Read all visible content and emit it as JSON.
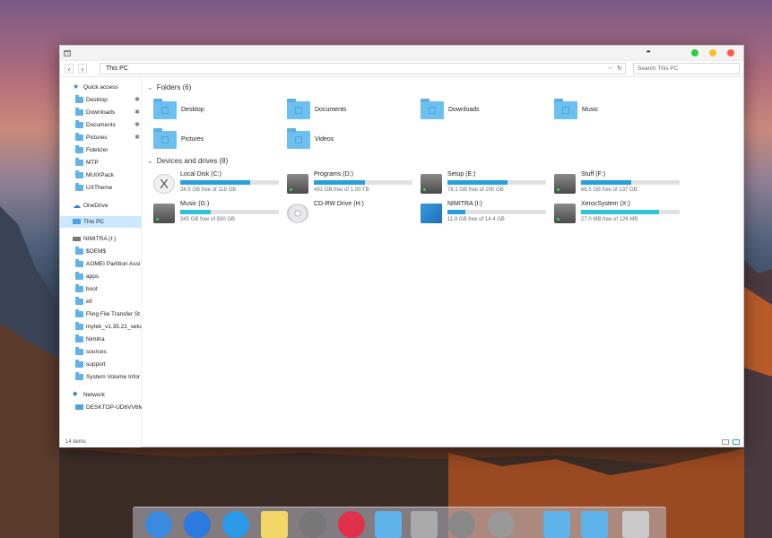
{
  "window": {
    "title_icon": "folder-window-icon",
    "dots": "••",
    "lights": {
      "green": "#2ecc40",
      "yellow": "#f5c023",
      "red": "#ff5a4f"
    }
  },
  "navbar": {
    "back": "‹",
    "forward": "›",
    "address": "This PC",
    "dropdown": "⌵",
    "refresh": "↻",
    "search_placeholder": "Search This PC"
  },
  "sidebar": {
    "items": [
      {
        "label": "Quick access",
        "icon": "star-icon",
        "pinned": false
      },
      {
        "label": "Desktop",
        "icon": "folder-icon",
        "pinned": true
      },
      {
        "label": "Downloads",
        "icon": "folder-icon",
        "pinned": true
      },
      {
        "label": "Documents",
        "icon": "folder-icon",
        "pinned": true
      },
      {
        "label": "Pictures",
        "icon": "folder-icon",
        "pinned": true
      },
      {
        "label": "Fidelizer",
        "icon": "folder-icon",
        "pinned": false
      },
      {
        "label": "MTP",
        "icon": "folder-icon",
        "pinned": false
      },
      {
        "label": "MUIXPack",
        "icon": "folder-icon",
        "pinned": false
      },
      {
        "label": "UXTheme",
        "icon": "folder-icon",
        "pinned": false
      },
      {
        "label": "OneDrive",
        "icon": "cloud-icon",
        "pinned": false
      },
      {
        "label": "This PC",
        "icon": "computer-icon",
        "pinned": false
      },
      {
        "label": "NIMITRA (I:)",
        "icon": "drive-icon",
        "pinned": false
      },
      {
        "label": "$OEM$",
        "icon": "folder-icon",
        "pinned": false
      },
      {
        "label": "AOMEI Partition Assi",
        "icon": "folder-icon",
        "pinned": false
      },
      {
        "label": "apps",
        "icon": "folder-icon",
        "pinned": false
      },
      {
        "label": "boot",
        "icon": "folder-icon",
        "pinned": false
      },
      {
        "label": "efi",
        "icon": "folder-icon",
        "pinned": false
      },
      {
        "label": "Fling File Transfer St",
        "icon": "folder-icon",
        "pinned": false
      },
      {
        "label": "mytek_v1.35.22_setu",
        "icon": "folder-icon",
        "pinned": false
      },
      {
        "label": "Nimitra",
        "icon": "folder-icon",
        "pinned": false
      },
      {
        "label": "sources",
        "icon": "folder-icon",
        "pinned": false
      },
      {
        "label": "support",
        "icon": "folder-icon",
        "pinned": false
      },
      {
        "label": "System Volume Infor",
        "icon": "folder-icon",
        "pinned": false
      },
      {
        "label": "Network",
        "icon": "network-icon",
        "pinned": false
      },
      {
        "label": "DESKTOP-UD6VV6M",
        "icon": "computer-icon",
        "pinned": false
      }
    ],
    "pin_glyph": "✱",
    "selected": "This PC"
  },
  "folders_section": {
    "title": "Folders (6)",
    "folders": [
      "Desktop",
      "Documents",
      "Downloads",
      "Music",
      "Pictures",
      "Videos"
    ]
  },
  "drives_section": {
    "title": "Devices and drives (8)",
    "drives": [
      {
        "name": "Local Disk (C:)",
        "free": "34.5 GB free of 118 GB",
        "used_fraction": 0.71,
        "icon": "macos-x-drive-icon"
      },
      {
        "name": "Programs (D:)",
        "free": "491 GB free of 1.00 TB",
        "used_fraction": 0.52,
        "icon": "hard-drive-icon"
      },
      {
        "name": "Setup (E:)",
        "free": "78.1 GB free of 200 GB",
        "used_fraction": 0.61,
        "icon": "hard-drive-icon"
      },
      {
        "name": "Stuff (F:)",
        "free": "66.5 GB free of 137 GB",
        "used_fraction": 0.51,
        "icon": "hard-drive-icon"
      },
      {
        "name": "Music (G:)",
        "free": "345 GB free of 500 GB",
        "used_fraction": 0.31,
        "icon": "hard-drive-icon"
      },
      {
        "name": "CD-RW Drive (H:)",
        "free": "",
        "used_fraction": null,
        "icon": "cd-drive-icon"
      },
      {
        "name": "NIMITRA (I:)",
        "free": "11.8 GB free of 14.4 GB",
        "used_fraction": 0.18,
        "icon": "setup-drive-icon"
      },
      {
        "name": "XerocSystem (X:)",
        "free": "27.0 MB free of 126 MB",
        "used_fraction": 0.79,
        "icon": "hard-drive-icon"
      }
    ]
  },
  "status": {
    "count": "14 items"
  },
  "dock": {
    "apps": [
      "finder-icon",
      "app-store-icon",
      "safari-icon",
      "notes-icon",
      "launchpad-icon",
      "itunes-icon",
      "folder-icon",
      "mac-pro-icon",
      "system-preferences-icon",
      "power-icon",
      "folder-icon",
      "folder-icon",
      "trash-icon"
    ]
  }
}
